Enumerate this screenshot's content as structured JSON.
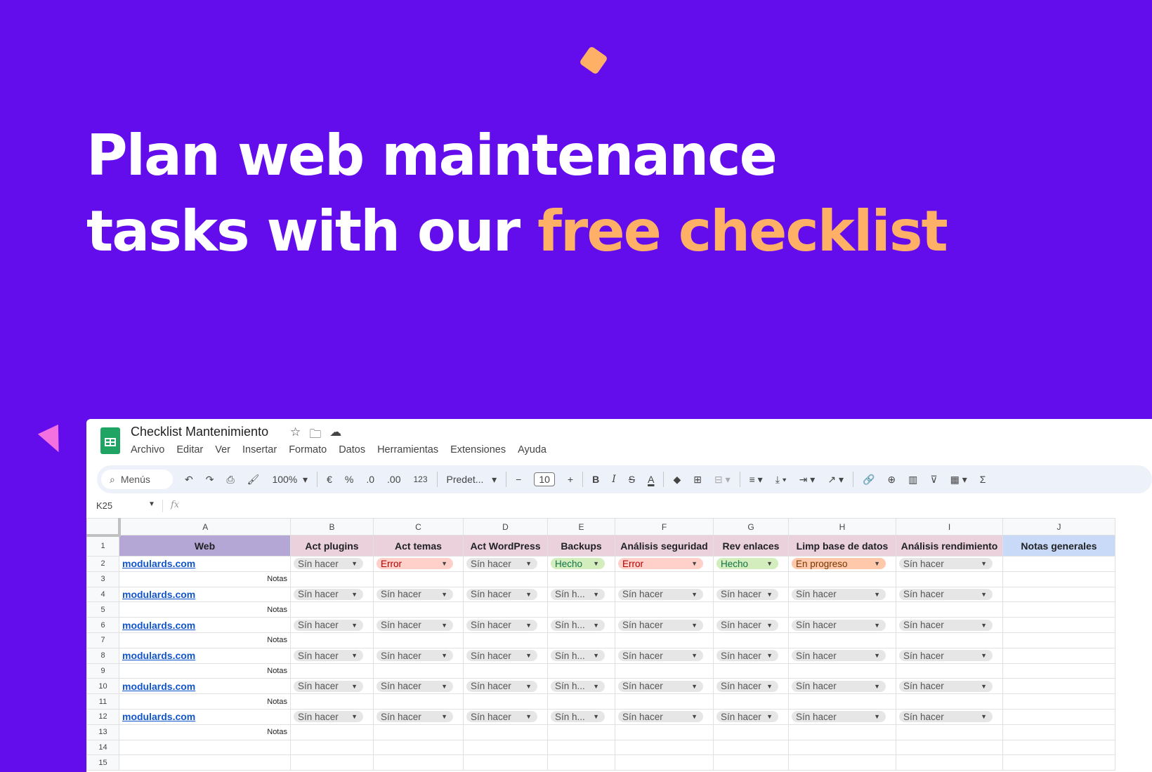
{
  "headline": {
    "line1": "Plan web maintenance",
    "line2_prefix": "tasks with our ",
    "line2_accent": "free checklist"
  },
  "colors": {
    "background": "#630cec",
    "accent": "#fdb066",
    "sheets_green": "#1fa463",
    "header_web": "#b4a7d6",
    "header_task": "#ead1dc",
    "header_notes": "#c9daf8"
  },
  "sheet": {
    "title": "Checklist Mantenimiento",
    "menu": [
      "Archivo",
      "Editar",
      "Ver",
      "Insertar",
      "Formato",
      "Datos",
      "Herramientas",
      "Extensiones",
      "Ayuda"
    ],
    "toolbar": {
      "search_label": "Menús",
      "zoom": "100%",
      "currency": "€",
      "percent": "%",
      "dec_decrease": ".0",
      "dec_increase": ".00",
      "number_format": "123",
      "font": "Predet...",
      "font_size": "10",
      "bold": "B",
      "italic": "I"
    },
    "cell_ref": "K25",
    "fx": "fx",
    "columns": [
      "A",
      "B",
      "C",
      "D",
      "E",
      "F",
      "G",
      "H",
      "I",
      "J"
    ],
    "headers": [
      "Web",
      "Act plugins",
      "Act temas",
      "Act WordPress",
      "Backups",
      "Análisis seguridad",
      "Rev enlaces",
      "Limp base de datos",
      "Análisis rendimiento",
      "Notas generales"
    ],
    "notes_label": "Notas",
    "row_numbers": [
      "1",
      "2",
      "3",
      "4",
      "5",
      "6",
      "7",
      "8",
      "9",
      "10",
      "11",
      "12",
      "13",
      "14",
      "15"
    ],
    "site_rows": [
      {
        "site": "modulards.com",
        "statuses": [
          "Sín hacer",
          "Error",
          "Sín hacer",
          "Hecho",
          "Error",
          "Hecho",
          "En progreso",
          "Sín hacer"
        ]
      },
      {
        "site": "modulards.com",
        "statuses": [
          "Sín hacer",
          "Sín hacer",
          "Sín hacer",
          "Sín h...",
          "Sín hacer",
          "Sín hacer",
          "Sín hacer",
          "Sín hacer"
        ]
      },
      {
        "site": "modulards.com",
        "statuses": [
          "Sín hacer",
          "Sín hacer",
          "Sín hacer",
          "Sín h...",
          "Sín hacer",
          "Sín hacer",
          "Sín hacer",
          "Sín hacer"
        ]
      },
      {
        "site": "modulards.com",
        "statuses": [
          "Sín hacer",
          "Sín hacer",
          "Sín hacer",
          "Sín h...",
          "Sín hacer",
          "Sín hacer",
          "Sín hacer",
          "Sín hacer"
        ]
      },
      {
        "site": "modulards.com",
        "statuses": [
          "Sín hacer",
          "Sín hacer",
          "Sín hacer",
          "Sín h...",
          "Sín hacer",
          "Sín hacer",
          "Sín hacer",
          "Sín hacer"
        ]
      },
      {
        "site": "modulards.com",
        "statuses": [
          "Sín hacer",
          "Sín hacer",
          "Sín hacer",
          "Sín h...",
          "Sín hacer",
          "Sín hacer",
          "Sín hacer",
          "Sín hacer"
        ]
      }
    ]
  }
}
